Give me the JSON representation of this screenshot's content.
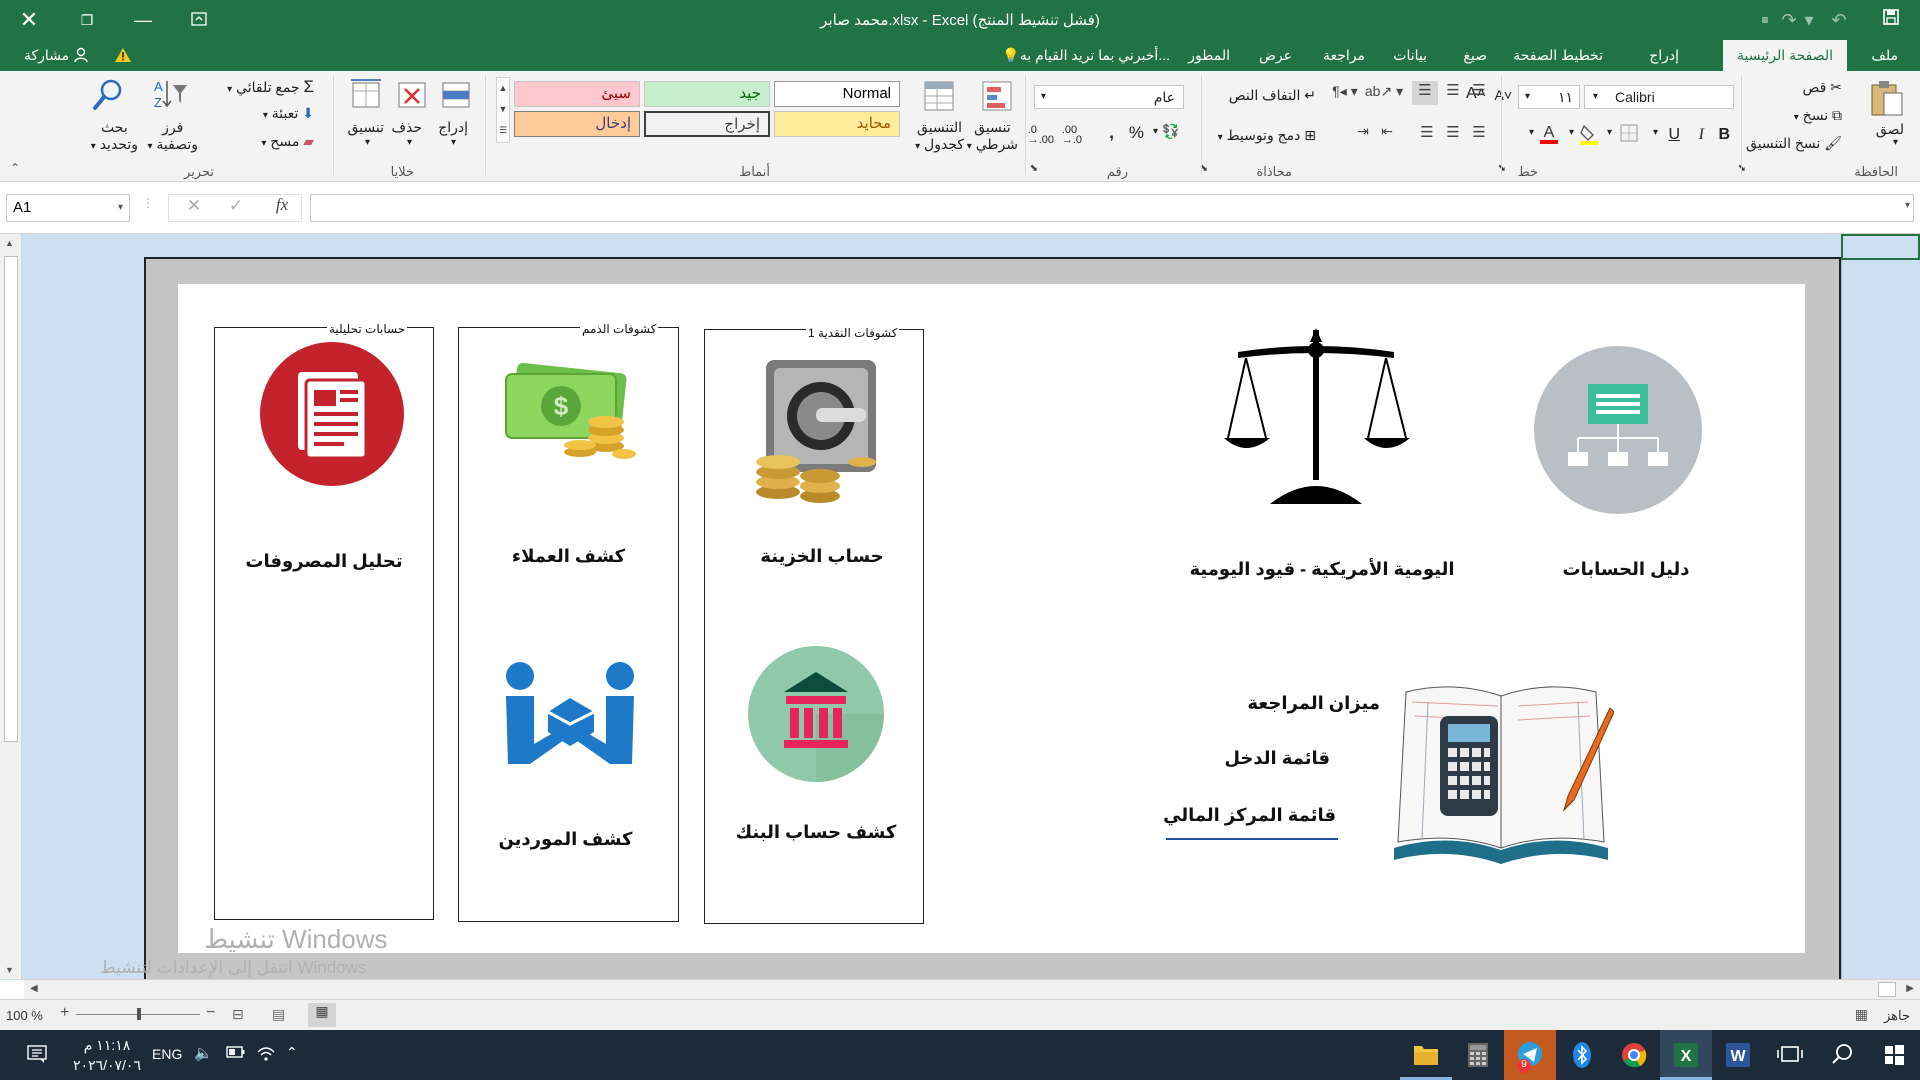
{
  "window": {
    "title": "محمد صابر.xlsx - Excel (فشل تنشيط المنتج)"
  },
  "ribbon_tabs": [
    {
      "label": "ملف"
    },
    {
      "label": "الصفحة الرئيسية",
      "active": true
    },
    {
      "label": "إدراج"
    },
    {
      "label": "تخطيط الصفحة"
    },
    {
      "label": "صيغ"
    },
    {
      "label": "بيانات"
    },
    {
      "label": "مراجعة"
    },
    {
      "label": "عرض"
    },
    {
      "label": "المطور"
    }
  ],
  "tellme": "أخبرني بما تريد القيام به...",
  "share": "مشاركة",
  "clipboard": {
    "paste": "لصق",
    "cut": "قص",
    "copy": "نسخ",
    "format_painter": "نسخ التنسيق",
    "group": "الحافظة"
  },
  "font": {
    "name": "Calibri",
    "size": "١١",
    "group": "خط",
    "bold": "B",
    "italic": "I",
    "underline": "U"
  },
  "alignment": {
    "wrap": "التفاف النص",
    "merge": "دمج وتوسيط",
    "group": "محاذاة"
  },
  "number": {
    "format": "عام",
    "group": "رقم"
  },
  "styles": {
    "conditional": [
      "تنسيق",
      "شرطي"
    ],
    "as_table": [
      "التنسيق",
      "كجدول"
    ],
    "cells": [
      {
        "label": "Normal",
        "bg": "#ffffff",
        "fg": "#000000"
      },
      {
        "label": "جيد",
        "bg": "#c6efce",
        "fg": "#006100"
      },
      {
        "label": "سيئ",
        "bg": "#ffc7ce",
        "fg": "#9c0006"
      },
      {
        "label": "محايد",
        "bg": "#ffeb9c",
        "fg": "#9c5700"
      },
      {
        "label": "إخراج",
        "bg": "#f2f2f2",
        "fg": "#3f3f3f"
      },
      {
        "label": "إدخال",
        "bg": "#ffcc99",
        "fg": "#3f3f76"
      }
    ],
    "group": "أنماط"
  },
  "cells_group": {
    "insert": "إدراج",
    "delete": "حذف",
    "format": "تنسيق",
    "group": "خلايا"
  },
  "editing": {
    "autosum": "جمع تلقائي",
    "fill": "تعبئة",
    "clear": "مسح",
    "sort": [
      "فرز",
      "وتصفية"
    ],
    "find": [
      "بحث",
      "وتحديد"
    ],
    "group": "تحرير"
  },
  "formula_bar": {
    "name_box": "A1",
    "fx": "fx",
    "value": ""
  },
  "sheet": {
    "panels": [
      {
        "label": "حسابات تحليلية"
      },
      {
        "label": "كشوفات الذمم"
      },
      {
        "label": "كشوفات النقدية 1"
      }
    ],
    "captions": {
      "expenses": "تحليل المصروفات",
      "customers": "كشف العملاء",
      "treasury": "حساب الخزينة",
      "suppliers": "كشف الموردين",
      "bank": "كشف حساب البنك",
      "journal": "اليومية الأمريكية - قيود اليومية",
      "chart_of_accounts": "دليل الحسابات",
      "trial_balance": "ميزان المراجعة",
      "income_statement": "قائمة الدخل",
      "financial_position": "قائمة المركز المالي"
    },
    "watermark": {
      "title": "تنشيط Windows",
      "sub": "انتقل إلى الإعدادات لتنشيط Windows"
    }
  },
  "status": {
    "ready": "جاهز",
    "zoom": "100 %"
  },
  "taskbar": {
    "time": "١١:١٨ م",
    "date": "٢٠٢٦/٠٧/٠٦",
    "lang": "ENG",
    "badge": "9"
  }
}
